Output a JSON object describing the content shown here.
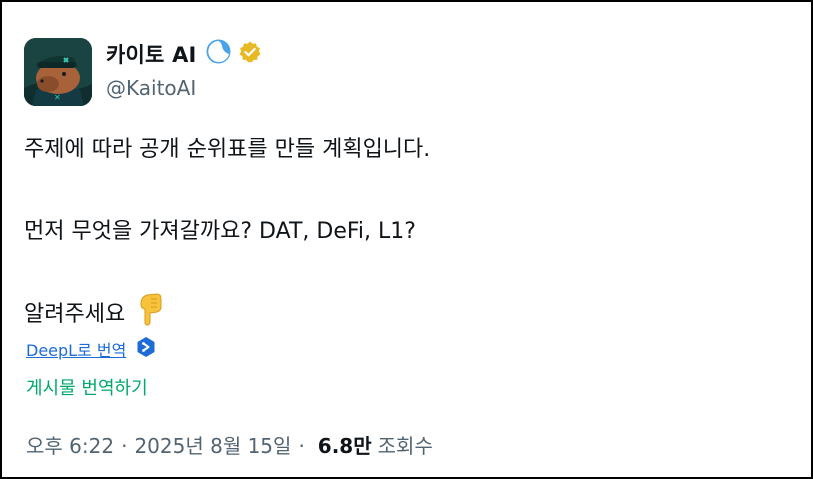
{
  "author": {
    "display_name": "카이토 AI",
    "handle": "@KaitoAI",
    "avatar_icon": "capybara-avatar-icon",
    "brand_badge_icon": "wave-badge-icon",
    "verified_badge_icon": "gold-verified-badge-icon"
  },
  "post": {
    "lines": [
      "주제에 따라 공개 순위표를 만들 계획입니다.",
      "먼저 무엇을 가져갈까요? DAT, DeFi, L1?",
      "알려주세요"
    ],
    "emoji_icon": "pointing-down-emoji-icon"
  },
  "translation": {
    "deepl_label": "DeepL로 번역",
    "translate_post_label": "게시물 번역하기"
  },
  "meta": {
    "time": "오후 6:22",
    "separator": "·",
    "date": "2025년 8월 15일",
    "views_count": "6.8만",
    "views_label": "조회수"
  },
  "colors": {
    "text": "#0f1419",
    "muted": "#536471",
    "link_blue": "#1d6bd6",
    "translate_green": "#00a86b",
    "verified_gold": "#e8b923"
  }
}
